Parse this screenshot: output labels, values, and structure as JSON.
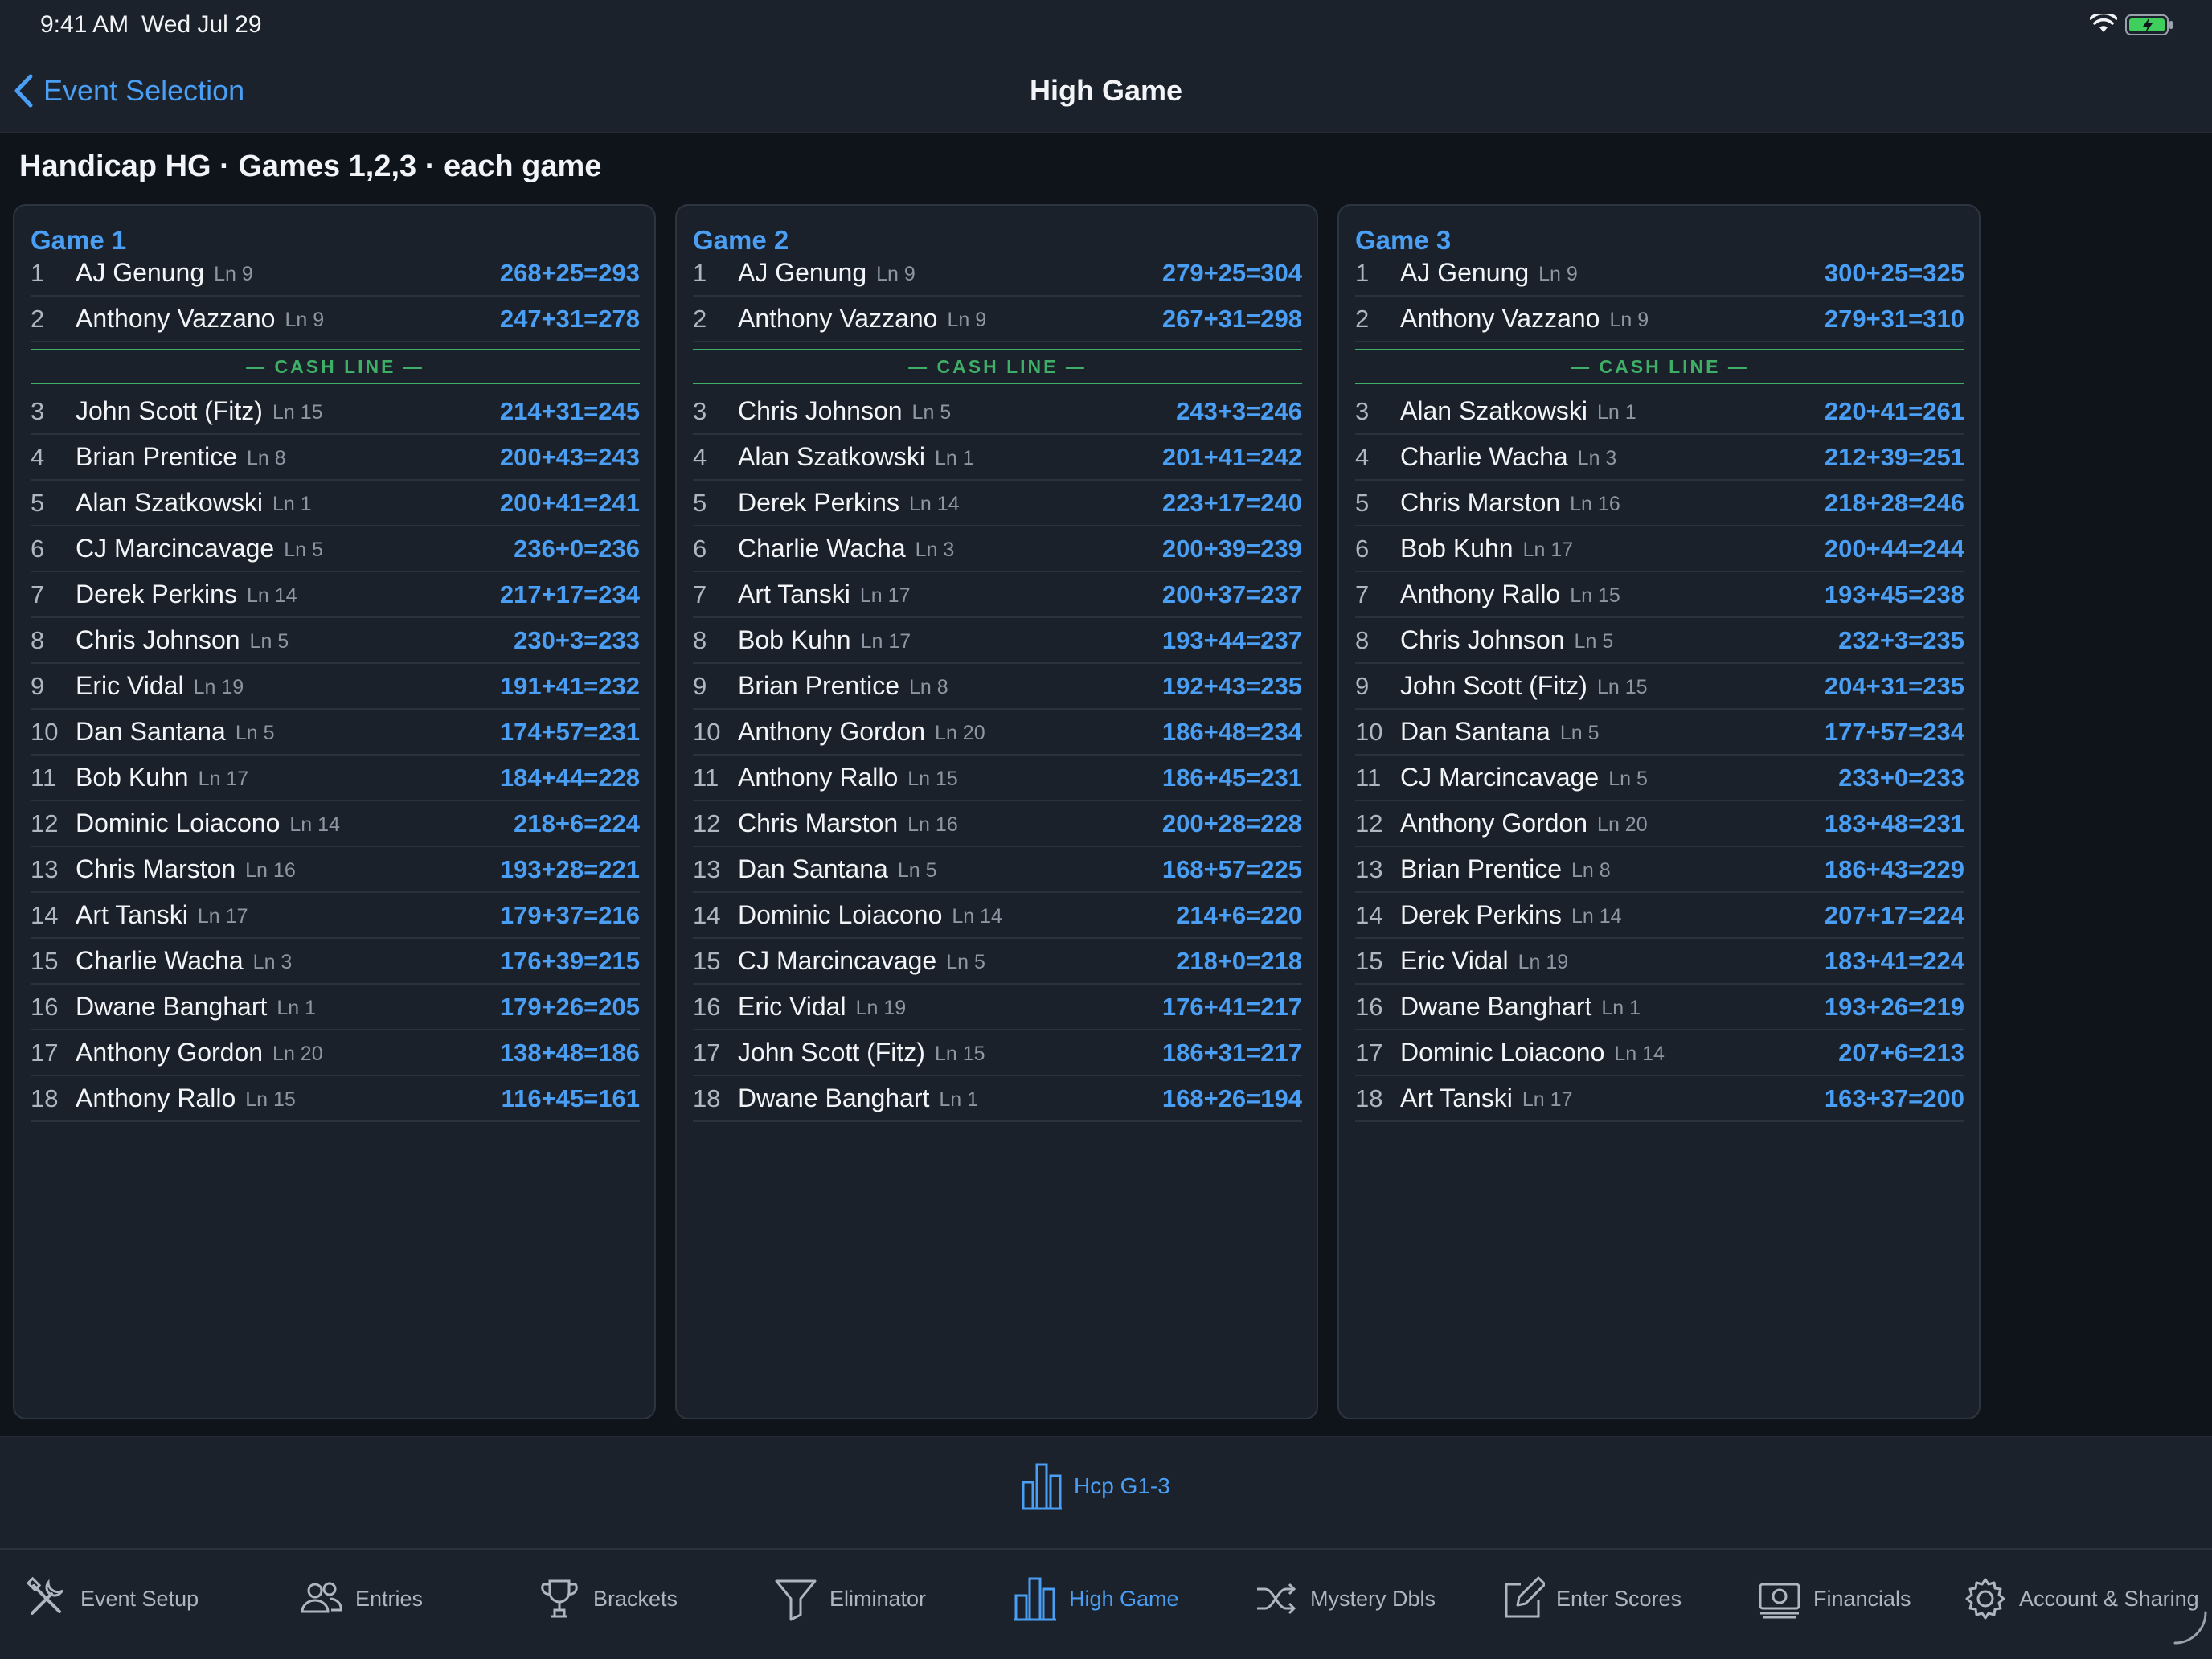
{
  "status": {
    "time": "9:41 AM",
    "date": "Wed Jul 29"
  },
  "nav": {
    "back_label": "Event Selection",
    "title": "High Game"
  },
  "heading": "Handicap HG · Games 1,2,3 · each game",
  "cash_line_label": "— CASH LINE —",
  "games": [
    {
      "title": "Game 1",
      "rows": [
        {
          "rank": "1",
          "name": "AJ Genung",
          "lane": "Ln 9",
          "score": "268+25=293"
        },
        {
          "rank": "2",
          "name": "Anthony Vazzano",
          "lane": "Ln 9",
          "score": "247+31=278"
        },
        {
          "rank": "3",
          "name": "John Scott (Fitz)",
          "lane": "Ln 15",
          "score": "214+31=245"
        },
        {
          "rank": "4",
          "name": "Brian Prentice",
          "lane": "Ln 8",
          "score": "200+43=243"
        },
        {
          "rank": "5",
          "name": "Alan Szatkowski",
          "lane": "Ln 1",
          "score": "200+41=241"
        },
        {
          "rank": "6",
          "name": "CJ Marcincavage",
          "lane": "Ln 5",
          "score": "236+0=236"
        },
        {
          "rank": "7",
          "name": "Derek Perkins",
          "lane": "Ln 14",
          "score": "217+17=234"
        },
        {
          "rank": "8",
          "name": "Chris Johnson",
          "lane": "Ln 5",
          "score": "230+3=233"
        },
        {
          "rank": "9",
          "name": "Eric Vidal",
          "lane": "Ln 19",
          "score": "191+41=232"
        },
        {
          "rank": "10",
          "name": "Dan Santana",
          "lane": "Ln 5",
          "score": "174+57=231"
        },
        {
          "rank": "11",
          "name": "Bob Kuhn",
          "lane": "Ln 17",
          "score": "184+44=228"
        },
        {
          "rank": "12",
          "name": "Dominic Loiacono",
          "lane": "Ln 14",
          "score": "218+6=224"
        },
        {
          "rank": "13",
          "name": "Chris Marston",
          "lane": "Ln 16",
          "score": "193+28=221"
        },
        {
          "rank": "14",
          "name": "Art Tanski",
          "lane": "Ln 17",
          "score": "179+37=216"
        },
        {
          "rank": "15",
          "name": "Charlie Wacha",
          "lane": "Ln 3",
          "score": "176+39=215"
        },
        {
          "rank": "16",
          "name": "Dwane Banghart",
          "lane": "Ln 1",
          "score": "179+26=205"
        },
        {
          "rank": "17",
          "name": "Anthony Gordon",
          "lane": "Ln 20",
          "score": "138+48=186"
        },
        {
          "rank": "18",
          "name": "Anthony Rallo",
          "lane": "Ln 15",
          "score": "116+45=161"
        }
      ]
    },
    {
      "title": "Game 2",
      "rows": [
        {
          "rank": "1",
          "name": "AJ Genung",
          "lane": "Ln 9",
          "score": "279+25=304"
        },
        {
          "rank": "2",
          "name": "Anthony Vazzano",
          "lane": "Ln 9",
          "score": "267+31=298"
        },
        {
          "rank": "3",
          "name": "Chris Johnson",
          "lane": "Ln 5",
          "score": "243+3=246"
        },
        {
          "rank": "4",
          "name": "Alan Szatkowski",
          "lane": "Ln 1",
          "score": "201+41=242"
        },
        {
          "rank": "5",
          "name": "Derek Perkins",
          "lane": "Ln 14",
          "score": "223+17=240"
        },
        {
          "rank": "6",
          "name": "Charlie Wacha",
          "lane": "Ln 3",
          "score": "200+39=239"
        },
        {
          "rank": "7",
          "name": "Art Tanski",
          "lane": "Ln 17",
          "score": "200+37=237"
        },
        {
          "rank": "8",
          "name": "Bob Kuhn",
          "lane": "Ln 17",
          "score": "193+44=237"
        },
        {
          "rank": "9",
          "name": "Brian Prentice",
          "lane": "Ln 8",
          "score": "192+43=235"
        },
        {
          "rank": "10",
          "name": "Anthony Gordon",
          "lane": "Ln 20",
          "score": "186+48=234"
        },
        {
          "rank": "11",
          "name": "Anthony Rallo",
          "lane": "Ln 15",
          "score": "186+45=231"
        },
        {
          "rank": "12",
          "name": "Chris Marston",
          "lane": "Ln 16",
          "score": "200+28=228"
        },
        {
          "rank": "13",
          "name": "Dan Santana",
          "lane": "Ln 5",
          "score": "168+57=225"
        },
        {
          "rank": "14",
          "name": "Dominic Loiacono",
          "lane": "Ln 14",
          "score": "214+6=220"
        },
        {
          "rank": "15",
          "name": "CJ Marcincavage",
          "lane": "Ln 5",
          "score": "218+0=218"
        },
        {
          "rank": "16",
          "name": "Eric Vidal",
          "lane": "Ln 19",
          "score": "176+41=217"
        },
        {
          "rank": "17",
          "name": "John Scott (Fitz)",
          "lane": "Ln 15",
          "score": "186+31=217"
        },
        {
          "rank": "18",
          "name": "Dwane Banghart",
          "lane": "Ln 1",
          "score": "168+26=194"
        }
      ]
    },
    {
      "title": "Game 3",
      "rows": [
        {
          "rank": "1",
          "name": "AJ Genung",
          "lane": "Ln 9",
          "score": "300+25=325"
        },
        {
          "rank": "2",
          "name": "Anthony Vazzano",
          "lane": "Ln 9",
          "score": "279+31=310"
        },
        {
          "rank": "3",
          "name": "Alan Szatkowski",
          "lane": "Ln 1",
          "score": "220+41=261"
        },
        {
          "rank": "4",
          "name": "Charlie Wacha",
          "lane": "Ln 3",
          "score": "212+39=251"
        },
        {
          "rank": "5",
          "name": "Chris Marston",
          "lane": "Ln 16",
          "score": "218+28=246"
        },
        {
          "rank": "6",
          "name": "Bob Kuhn",
          "lane": "Ln 17",
          "score": "200+44=244"
        },
        {
          "rank": "7",
          "name": "Anthony Rallo",
          "lane": "Ln 15",
          "score": "193+45=238"
        },
        {
          "rank": "8",
          "name": "Chris Johnson",
          "lane": "Ln 5",
          "score": "232+3=235"
        },
        {
          "rank": "9",
          "name": "John Scott (Fitz)",
          "lane": "Ln 15",
          "score": "204+31=235"
        },
        {
          "rank": "10",
          "name": "Dan Santana",
          "lane": "Ln 5",
          "score": "177+57=234"
        },
        {
          "rank": "11",
          "name": "CJ Marcincavage",
          "lane": "Ln 5",
          "score": "233+0=233"
        },
        {
          "rank": "12",
          "name": "Anthony Gordon",
          "lane": "Ln 20",
          "score": "183+48=231"
        },
        {
          "rank": "13",
          "name": "Brian Prentice",
          "lane": "Ln 8",
          "score": "186+43=229"
        },
        {
          "rank": "14",
          "name": "Derek Perkins",
          "lane": "Ln 14",
          "score": "207+17=224"
        },
        {
          "rank": "15",
          "name": "Eric Vidal",
          "lane": "Ln 19",
          "score": "183+41=224"
        },
        {
          "rank": "16",
          "name": "Dwane Banghart",
          "lane": "Ln 1",
          "score": "193+26=219"
        },
        {
          "rank": "17",
          "name": "Dominic Loiacono",
          "lane": "Ln 14",
          "score": "207+6=213"
        },
        {
          "rank": "18",
          "name": "Art Tanski",
          "lane": "Ln 17",
          "score": "163+37=200"
        }
      ]
    }
  ],
  "sub_bar": {
    "segment_label": "Hcp G1-3",
    "segment_icon": "bar-chart-icon"
  },
  "tabs": [
    {
      "label": "Event Setup",
      "icon": "tools-icon",
      "active": false
    },
    {
      "label": "Entries",
      "icon": "people-icon",
      "active": false
    },
    {
      "label": "Brackets",
      "icon": "trophy-icon",
      "active": false
    },
    {
      "label": "Eliminator",
      "icon": "funnel-icon",
      "active": false
    },
    {
      "label": "High Game",
      "icon": "bar-chart-icon",
      "active": true
    },
    {
      "label": "Mystery Dbls",
      "icon": "shuffle-icon",
      "active": false
    },
    {
      "label": "Enter Scores",
      "icon": "edit-icon",
      "active": false
    },
    {
      "label": "Financials",
      "icon": "money-icon",
      "active": false
    },
    {
      "label": "Account & Sharing",
      "icon": "gear-icon",
      "active": false
    }
  ],
  "colors": {
    "accent": "#4a9ff5",
    "cash_line": "#3fae66",
    "background": "#0f141a",
    "panel": "#1a212a"
  }
}
